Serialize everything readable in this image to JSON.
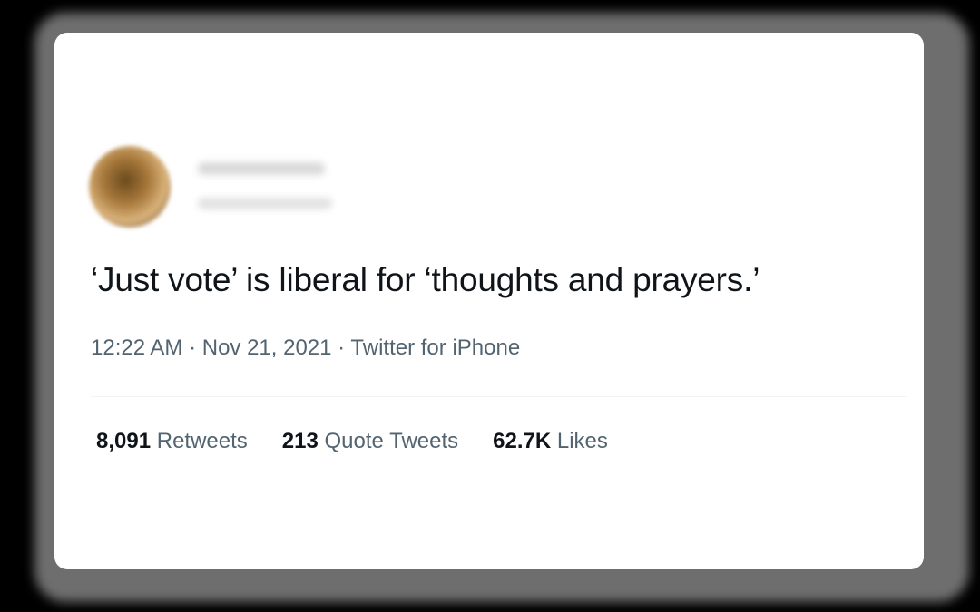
{
  "tweet": {
    "text": "‘Just vote’ is liberal for ‘thoughts and prayers.’",
    "time": "12:22 AM",
    "date": "Nov 21, 2021",
    "source": "Twitter for iPhone",
    "separator": " · "
  },
  "stats": {
    "retweets_count": "8,091",
    "retweets_label": "Retweets",
    "quotes_count": "213",
    "quotes_label": "Quote Tweets",
    "likes_count": "62.7K",
    "likes_label": "Likes"
  },
  "colors": {
    "text": "#0f1419",
    "secondary": "#536471",
    "divider": "#eff3f4",
    "card_background": "#ffffff",
    "page_background": "#000000"
  }
}
